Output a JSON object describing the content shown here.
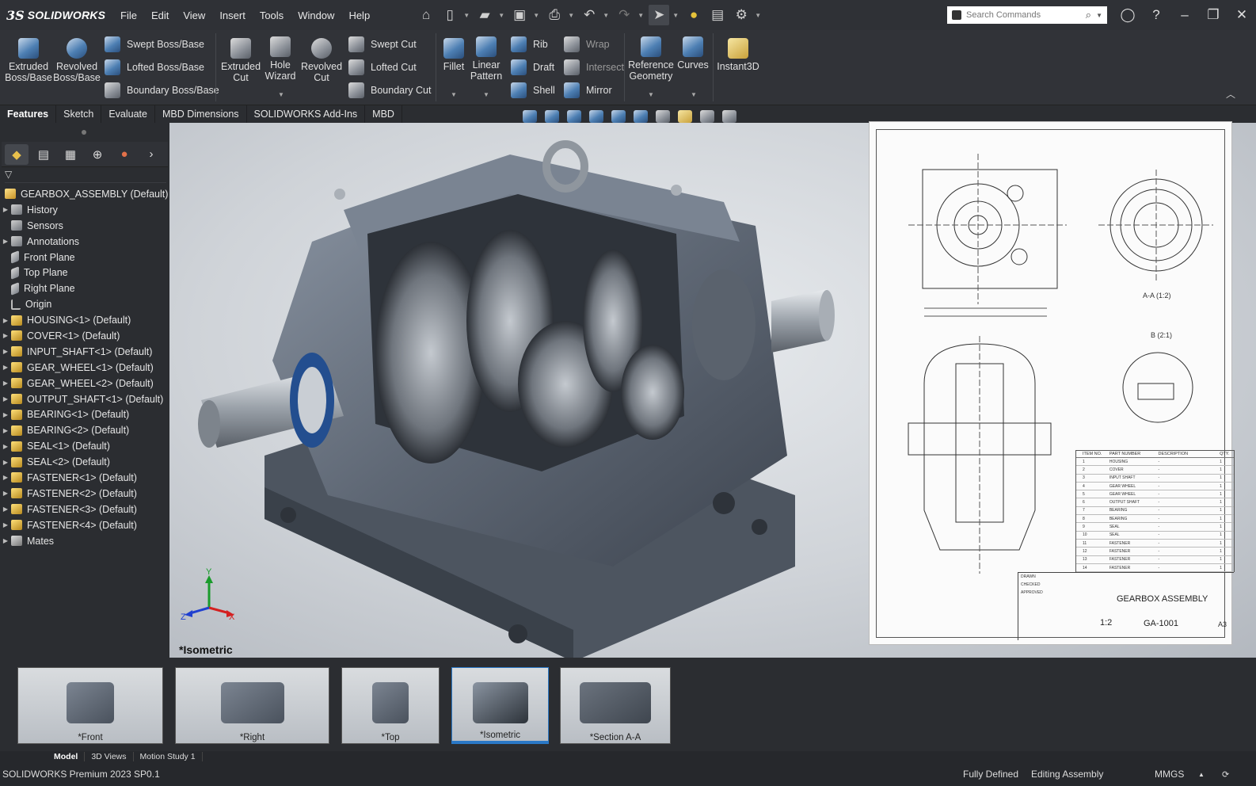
{
  "app": {
    "logo_mark": "3S",
    "logo_text": "SOLIDWORKS"
  },
  "menu": [
    "File",
    "Edit",
    "View",
    "Insert",
    "Tools",
    "Window",
    "Help"
  ],
  "search": {
    "placeholder": "Search Commands"
  },
  "ribbon": {
    "extruded_boss": "Extruded Boss/Base",
    "revolved_boss": "Revolved Boss/Base",
    "swept_boss": "Swept Boss/Base",
    "lofted_boss": "Lofted Boss/Base",
    "boundary_boss": "Boundary Boss/Base",
    "extruded_cut": "Extruded Cut",
    "hole_wizard": "Hole Wizard",
    "revolved_cut": "Revolved Cut",
    "swept_cut": "Swept Cut",
    "lofted_cut": "Lofted Cut",
    "boundary_cut": "Boundary Cut",
    "fillet": "Fillet",
    "linear_pattern": "Linear Pattern",
    "rib": "Rib",
    "draft": "Draft",
    "shell": "Shell",
    "wrap": "Wrap",
    "intersect": "Intersect",
    "mirror": "Mirror",
    "reference_geometry": "Reference Geometry",
    "curves": "Curves",
    "instant3d": "Instant3D"
  },
  "tabs": [
    "Features",
    "Sketch",
    "Evaluate",
    "MBD Dimensions",
    "SOLIDWORKS Add-Ins",
    "MBD"
  ],
  "tree": {
    "root": "GEARBOX_ASSEMBLY  (Default)",
    "items": [
      {
        "label": "History",
        "icon": "folder-icon",
        "expand": true
      },
      {
        "label": "Sensors",
        "icon": "folder-icon",
        "expand": false
      },
      {
        "label": "Annotations",
        "icon": "folder-icon",
        "expand": true
      },
      {
        "label": "Front Plane",
        "icon": "plane-icon",
        "expand": false
      },
      {
        "label": "Top Plane",
        "icon": "plane-icon",
        "expand": false
      },
      {
        "label": "Right Plane",
        "icon": "plane-icon",
        "expand": false
      },
      {
        "label": "Origin",
        "icon": "origin-icon",
        "expand": false
      },
      {
        "label": "HOUSING<1> (Default)",
        "icon": "part-icon",
        "expand": true
      },
      {
        "label": "COVER<1> (Default)",
        "icon": "part-icon",
        "expand": true
      },
      {
        "label": "INPUT_SHAFT<1> (Default)",
        "icon": "part-icon",
        "expand": true
      },
      {
        "label": "GEAR_WHEEL<1> (Default)",
        "icon": "part-icon",
        "expand": true
      },
      {
        "label": "GEAR_WHEEL<2> (Default)",
        "icon": "part-icon",
        "expand": true
      },
      {
        "label": "OUTPUT_SHAFT<1> (Default)",
        "icon": "part-icon",
        "expand": true
      },
      {
        "label": "BEARING<1> (Default)",
        "icon": "part-icon",
        "expand": true
      },
      {
        "label": "BEARING<2> (Default)",
        "icon": "part-icon",
        "expand": true
      },
      {
        "label": "SEAL<1> (Default)",
        "icon": "part-icon",
        "expand": true
      },
      {
        "label": "SEAL<2> (Default)",
        "icon": "part-icon",
        "expand": true
      },
      {
        "label": "FASTENER<1> (Default)",
        "icon": "part-icon",
        "expand": true
      },
      {
        "label": "FASTENER<2> (Default)",
        "icon": "part-icon",
        "expand": true
      },
      {
        "label": "FASTENER<3> (Default)",
        "icon": "part-icon",
        "expand": true
      },
      {
        "label": "FASTENER<4> (Default)",
        "icon": "part-icon",
        "expand": true
      },
      {
        "label": "Mates",
        "icon": "mates-icon",
        "expand": true
      }
    ]
  },
  "viewport": {
    "view_label": "*Isometric",
    "axes": {
      "x": "X",
      "y": "Y",
      "z": "Z"
    }
  },
  "drawing": {
    "title": "GEARBOX ASSEMBLY",
    "number": "GA-1001",
    "scale": "1:2",
    "size": "A3",
    "section_label": "A-A (1:2)",
    "detail_label": "B (2:1)",
    "drawn": "DRAWN",
    "checked": "CHECKED",
    "approved": "APPROVED",
    "bom_headers": [
      "ITEM NO.",
      "PART NUMBER",
      "DESCRIPTION",
      "QTY."
    ],
    "bom_rows": [
      [
        "1",
        "HOUSING",
        "-",
        "1"
      ],
      [
        "2",
        "COVER",
        "-",
        "1"
      ],
      [
        "3",
        "INPUT SHAFT",
        "-",
        "1"
      ],
      [
        "4",
        "GEAR WHEEL",
        "-",
        "1"
      ],
      [
        "5",
        "GEAR WHEEL",
        "-",
        "1"
      ],
      [
        "6",
        "OUTPUT SHAFT",
        "-",
        "1"
      ],
      [
        "7",
        "BEARING",
        "-",
        "1"
      ],
      [
        "8",
        "BEARING",
        "-",
        "1"
      ],
      [
        "9",
        "SEAL",
        "-",
        "1"
      ],
      [
        "10",
        "SEAL",
        "-",
        "1"
      ],
      [
        "11",
        "FASTENER",
        "-",
        "1"
      ],
      [
        "12",
        "FASTENER",
        "-",
        "1"
      ],
      [
        "13",
        "FASTENER",
        "-",
        "1"
      ],
      [
        "14",
        "FASTENER",
        "-",
        "1"
      ]
    ]
  },
  "thumbnails": [
    "*Front",
    "*Right",
    "*Top",
    "*Isometric",
    "*Section A-A"
  ],
  "bottom_tabs": [
    "Model",
    "3D Views",
    "Motion Study 1"
  ],
  "status": {
    "product": "SOLIDWORKS Premium 2023 SP0.1",
    "defined": "Fully Defined",
    "mode": "Editing Assembly",
    "units": "MMGS"
  },
  "colors": {
    "accent": "#2a78c6",
    "ui_dark": "#2b2d31",
    "part_yellow": "#e0b33a"
  }
}
